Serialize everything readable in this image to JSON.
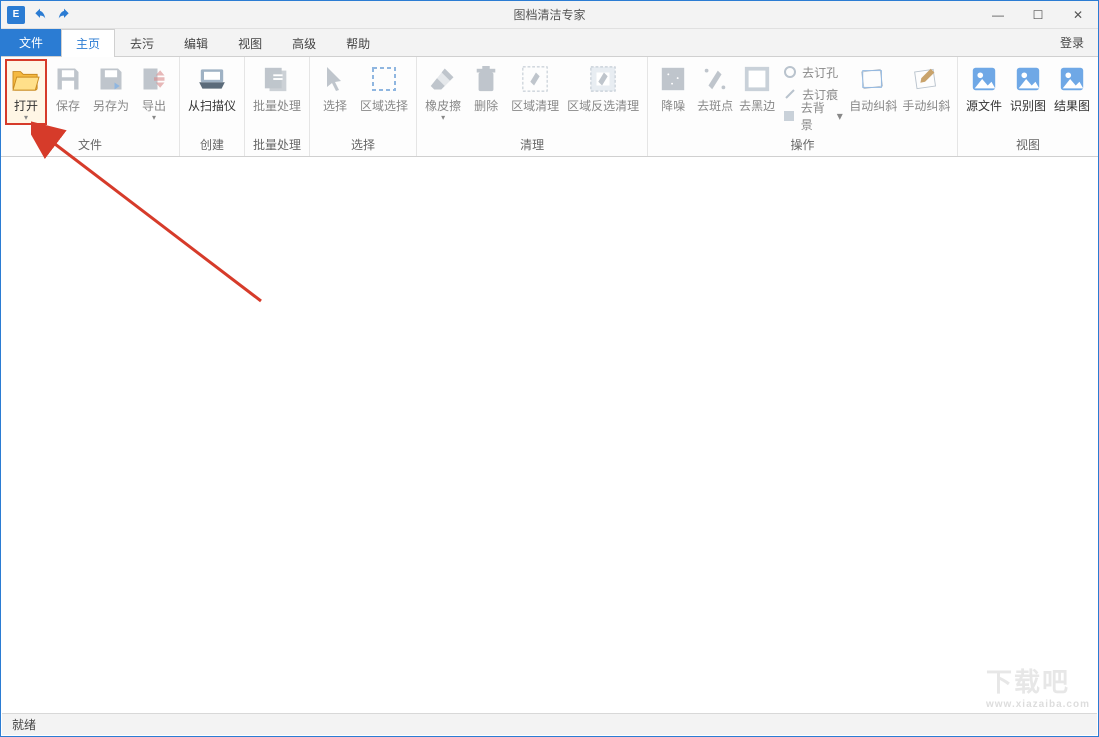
{
  "title": "图档清洁专家",
  "qat": {
    "undo_tip": "撤销",
    "redo_tip": "重做"
  },
  "win": {
    "min": "—",
    "max": "☐",
    "close": "✕"
  },
  "tabs": {
    "file": "文件",
    "items": [
      "主页",
      "去污",
      "编辑",
      "视图",
      "高级",
      "帮助"
    ],
    "active_index": 0,
    "login": "登录"
  },
  "ribbon": {
    "groups": [
      {
        "label": "文件",
        "buttons": [
          {
            "id": "open",
            "label": "打开",
            "enabled": true,
            "dropdown": true,
            "highlight": true
          },
          {
            "id": "save",
            "label": "保存",
            "enabled": false
          },
          {
            "id": "saveas",
            "label": "另存为",
            "enabled": false
          },
          {
            "id": "export",
            "label": "导出",
            "enabled": false,
            "dropdown": true
          }
        ]
      },
      {
        "label": "创建",
        "buttons": [
          {
            "id": "fromscanner",
            "label": "从扫描仪",
            "enabled": true
          }
        ]
      },
      {
        "label": "批量处理",
        "buttons": [
          {
            "id": "batch",
            "label": "批量处理",
            "enabled": false
          }
        ]
      },
      {
        "label": "选择",
        "buttons": [
          {
            "id": "select",
            "label": "选择",
            "enabled": false
          },
          {
            "id": "regionselect",
            "label": "区域选择",
            "enabled": false
          }
        ]
      },
      {
        "label": "清理",
        "buttons": [
          {
            "id": "eraser",
            "label": "橡皮擦",
            "enabled": false,
            "dropdown": true
          },
          {
            "id": "delete",
            "label": "删除",
            "enabled": false
          },
          {
            "id": "regionclean",
            "label": "区域清理",
            "enabled": false
          },
          {
            "id": "regioninvclean",
            "label": "区域反选清理",
            "enabled": false
          }
        ]
      },
      {
        "label": "操作",
        "buttons": [
          {
            "id": "denoise",
            "label": "降噪",
            "enabled": false
          },
          {
            "id": "despeckle",
            "label": "去斑点",
            "enabled": false
          },
          {
            "id": "deborder",
            "label": "去黑边",
            "enabled": false
          }
        ],
        "small_buttons": [
          {
            "id": "depunch",
            "label": "去订孔"
          },
          {
            "id": "destaple",
            "label": "去订痕"
          },
          {
            "id": "debg",
            "label": "去背景",
            "dropdown": true
          }
        ],
        "tail_buttons": [
          {
            "id": "autodeskew",
            "label": "自动纠斜",
            "enabled": false
          },
          {
            "id": "manualdeskew",
            "label": "手动纠斜",
            "enabled": false
          }
        ]
      },
      {
        "label": "视图",
        "buttons": [
          {
            "id": "srcimg",
            "label": "源文件",
            "enabled": true
          },
          {
            "id": "recogimg",
            "label": "识别图",
            "enabled": true
          },
          {
            "id": "resultimg",
            "label": "结果图",
            "enabled": true
          }
        ]
      }
    ]
  },
  "status": {
    "text": "就绪"
  },
  "watermark": {
    "main": "下载吧",
    "sub": "www.xiazaiba.com"
  }
}
